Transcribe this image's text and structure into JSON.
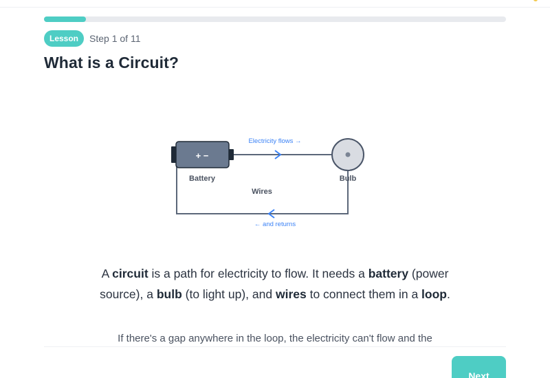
{
  "progress": {
    "fraction": 0.0907
  },
  "header": {
    "badge": "Lesson",
    "step": "Step 1 of 11"
  },
  "page": {
    "title": "What is a Circuit?"
  },
  "diagram": {
    "battery_symbol": "+ −",
    "battery_label": "Battery",
    "bulb_label": "Bulb",
    "wires_label": "Wires",
    "flow_label": "Electricity flows →",
    "return_label": "← and returns"
  },
  "paragraph": {
    "p1_a": "A ",
    "p1_b": "circuit",
    "p1_c": " is a path for electricity to flow. It needs a ",
    "p1_d": "battery",
    "p1_e": " (power source), a ",
    "p1_f": "bulb",
    "p1_g": " (to light up), and ",
    "p1_h": "wires",
    "p1_i": " to connect them in a ",
    "p1_j": "loop",
    "p1_k": ".",
    "p2": "If there's a gap anywhere in the loop, the electricity can't flow and the"
  },
  "footer": {
    "next_label": "Next"
  },
  "colors": {
    "accent": "#4ecdc4",
    "flow": "#3b82f6",
    "wire": "#5b6779",
    "battery": "#6b7a90"
  }
}
